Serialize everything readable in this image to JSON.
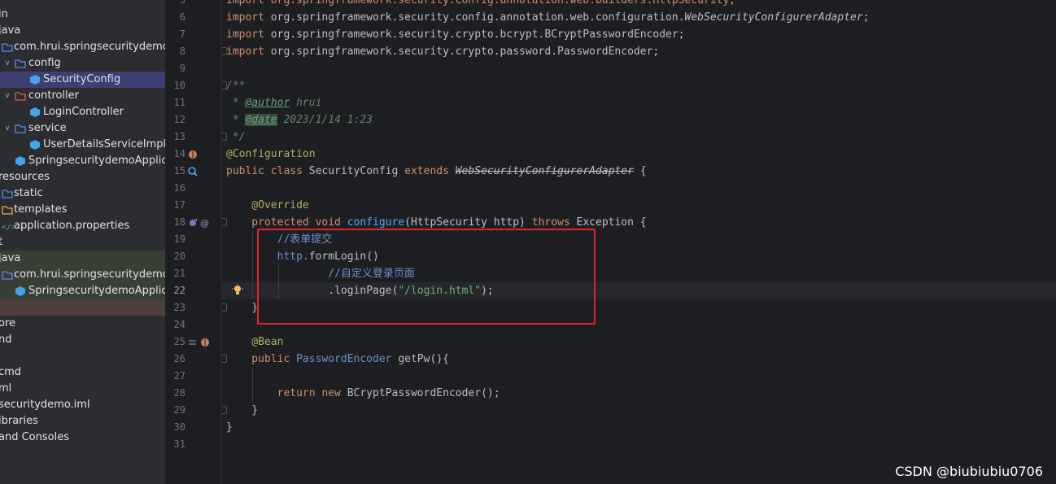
{
  "tree": {
    "items": [
      {
        "label": "in",
        "icon": "folder-icon"
      },
      {
        "label": "java",
        "icon": "source-folder-icon"
      },
      {
        "label": "com.hrui.springsecuritydemo",
        "icon": "package-icon"
      },
      {
        "label": "config",
        "icon": "package-config-icon"
      },
      {
        "label": "SecurityConfig",
        "icon": "class-icon"
      },
      {
        "label": "controller",
        "icon": "package-controller-icon"
      },
      {
        "label": "LoginController",
        "icon": "class-icon"
      },
      {
        "label": "service",
        "icon": "package-service-icon"
      },
      {
        "label": "UserDetailsServiceImpl",
        "icon": "class-icon"
      },
      {
        "label": "SpringsecuritydemoApplicati",
        "icon": "spring-app-icon"
      },
      {
        "label": "resources",
        "icon": "resources-folder-icon"
      },
      {
        "label": "static",
        "icon": "web-folder-icon"
      },
      {
        "label": "templates",
        "icon": "folder-icon"
      },
      {
        "label": "application.properties",
        "icon": "properties-icon"
      },
      {
        "label": "t",
        "icon": "folder-icon"
      },
      {
        "label": "java",
        "icon": "test-folder-icon"
      },
      {
        "label": "com.hrui.springsecuritydemo",
        "icon": "package-icon"
      },
      {
        "label": "SpringsecuritydemoApplicati",
        "icon": "spring-app-icon"
      },
      {
        "label": "",
        "icon": ""
      },
      {
        "label": "ore",
        "icon": ""
      },
      {
        "label": "nd",
        "icon": ""
      },
      {
        "label": "",
        "icon": ""
      },
      {
        "label": "cmd",
        "icon": ""
      },
      {
        "label": "ml",
        "icon": ""
      },
      {
        "label": "securitydemo.iml",
        "icon": ""
      },
      {
        "label": "ibraries",
        "icon": ""
      },
      {
        "label": " and Consoles",
        "icon": ""
      }
    ]
  },
  "editor": {
    "line_numbers": [
      "5",
      "6",
      "7",
      "8",
      "9",
      "10",
      "11",
      "12",
      "13",
      "14",
      "15",
      "16",
      "17",
      "18",
      "19",
      "20",
      "21",
      "22",
      "23",
      "24",
      "25",
      "26",
      "27",
      "28",
      "29",
      "30",
      "31"
    ],
    "current_line": "22",
    "code": {
      "l5": "import org.springframework.security.config.annotation.web.builders.HttpSecurity;",
      "l6_a": "import ",
      "l6_b": "org.springframework.security.config.annotation.web.configuration.",
      "l6_c": "WebSecurityConfigurerAdapter",
      "l6_d": ";",
      "l7_a": "import ",
      "l7_b": "org.springframework.security.crypto.bcrypt.BCryptPasswordEncoder;",
      "l8_a": "import ",
      "l8_b": "org.springframework.security.crypto.password.PasswordEncoder;",
      "l10": "/**",
      "l11_a": " * ",
      "l11_b": "@author",
      "l11_c": " hrui",
      "l12_a": " * ",
      "l12_b": "@date",
      "l12_c": " 2023/1/14 1:23",
      "l13": " */",
      "l14": "@Configuration",
      "l15_a": "public class ",
      "l15_b": "SecurityConfig ",
      "l15_c": "extends ",
      "l15_d": "WebSecurityConfigurerAdapter",
      "l15_e": " {",
      "l17": "    @Override",
      "l18_a": "    protected void ",
      "l18_b": "configure",
      "l18_c": "(HttpSecurity http) ",
      "l18_d": "throws ",
      "l18_e": "Exception {",
      "l19": "        //表单提交",
      "l20_a": "        http.",
      "l20_b": "formLogin",
      "l20_c": "()",
      "l21": "                //自定义登录页面",
      "l22_a": "                .",
      "l22_b": "loginPage",
      "l22_c": "(",
      "l22_d": "\"/login.html\"",
      "l22_e": ");",
      "l23": "    }",
      "l25": "    @Bean",
      "l26_a": "    public ",
      "l26_b": "PasswordEncoder ",
      "l26_c": "getPw",
      "l26_d": "(){",
      "l28_a": "        return new ",
      "l28_b": "BCryptPasswordEncoder",
      "l28_c": "();",
      "l29": "    }",
      "l30": "}"
    }
  },
  "watermark": "CSDN @biubiubiu0706",
  "colors": {
    "keyword": "#cf8e6d",
    "annotation": "#b3ae60",
    "string": "#6aab73",
    "comment": "#6f8ecf",
    "highlight_box": "#e0252b",
    "selection": "#3d3f72"
  }
}
